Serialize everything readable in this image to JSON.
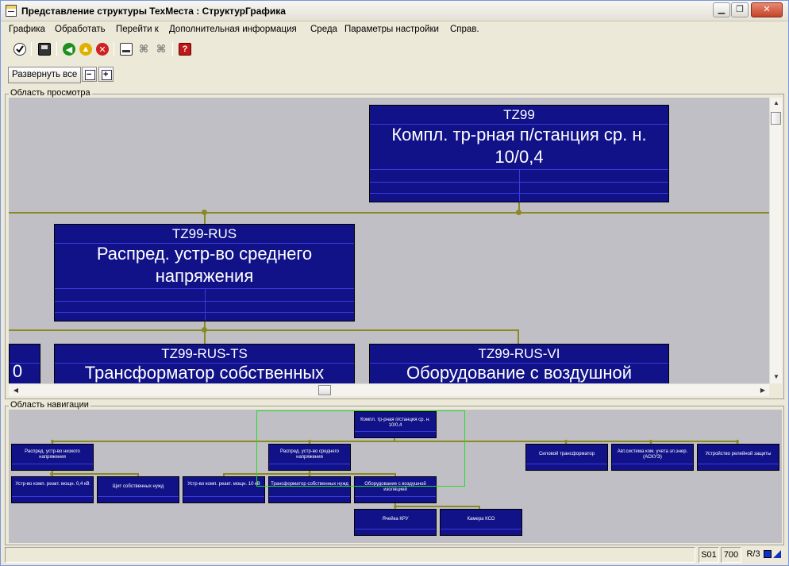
{
  "window": {
    "title": "Представление структуры ТехМеста : СтруктурГрафика",
    "min_label": "▁",
    "restore_label": "❐",
    "close_label": "✕"
  },
  "menu": [
    "Графика",
    "Обработать",
    "Перейти к",
    "Дополнительная информация",
    "Среда",
    "Параметры настройки",
    "Справ."
  ],
  "toolbar": {
    "icons": [
      "check-icon",
      "save-icon",
      "back-icon",
      "exit-icon",
      "cancel-icon",
      "print-icon",
      "find-icon",
      "find-next-icon",
      "help-icon"
    ]
  },
  "appbar": {
    "expand_all": "Развернуть все",
    "collapse_symbol": "−",
    "expand_symbol": "+"
  },
  "view_area": {
    "label": "Область просмотра",
    "nodes": [
      {
        "id": "TZ99",
        "desc": "Компл. тр-рная п/станция ср. н. 10/0,4"
      },
      {
        "id": "TZ99-RUS",
        "desc": "Распред. устр-во среднего напряжения"
      },
      {
        "id": "",
        "desc": "0"
      },
      {
        "id": "TZ99-RUS-TS",
        "desc": "Трансформатор собственных"
      },
      {
        "id": "TZ99-RUS-VI",
        "desc": "Оборудование с воздушной"
      }
    ]
  },
  "nav_area": {
    "label": "Область навигации",
    "nodes": [
      "Компл. тр-рная п/станция ср. н. 10/0,4",
      "Распред. устр-во низкого напряжения",
      "Распред. устр-во среднего напряжения",
      "Силовой трансформатор",
      "Авт.система ком. учета эл.энер. (АСКУЭ)",
      "Устройство релейной защиты",
      "Устр-во комп. реакт. мощн. 0,4 кВ",
      "Щит собственных нужд",
      "Устр-во комп. реакт. мощн. 10 кВ",
      "Трансформатор собственных нужд",
      "Оборудование с воздушной изоляцией",
      "Ячейка КРУ",
      "Камера КСО"
    ]
  },
  "status": {
    "system": "S01",
    "client": "700",
    "mode": "R/3"
  },
  "colors": {
    "node_fill": "#111188",
    "connector": "#8a8a22",
    "canvas": "#c0bfc6",
    "viewport": "#22dd22"
  }
}
